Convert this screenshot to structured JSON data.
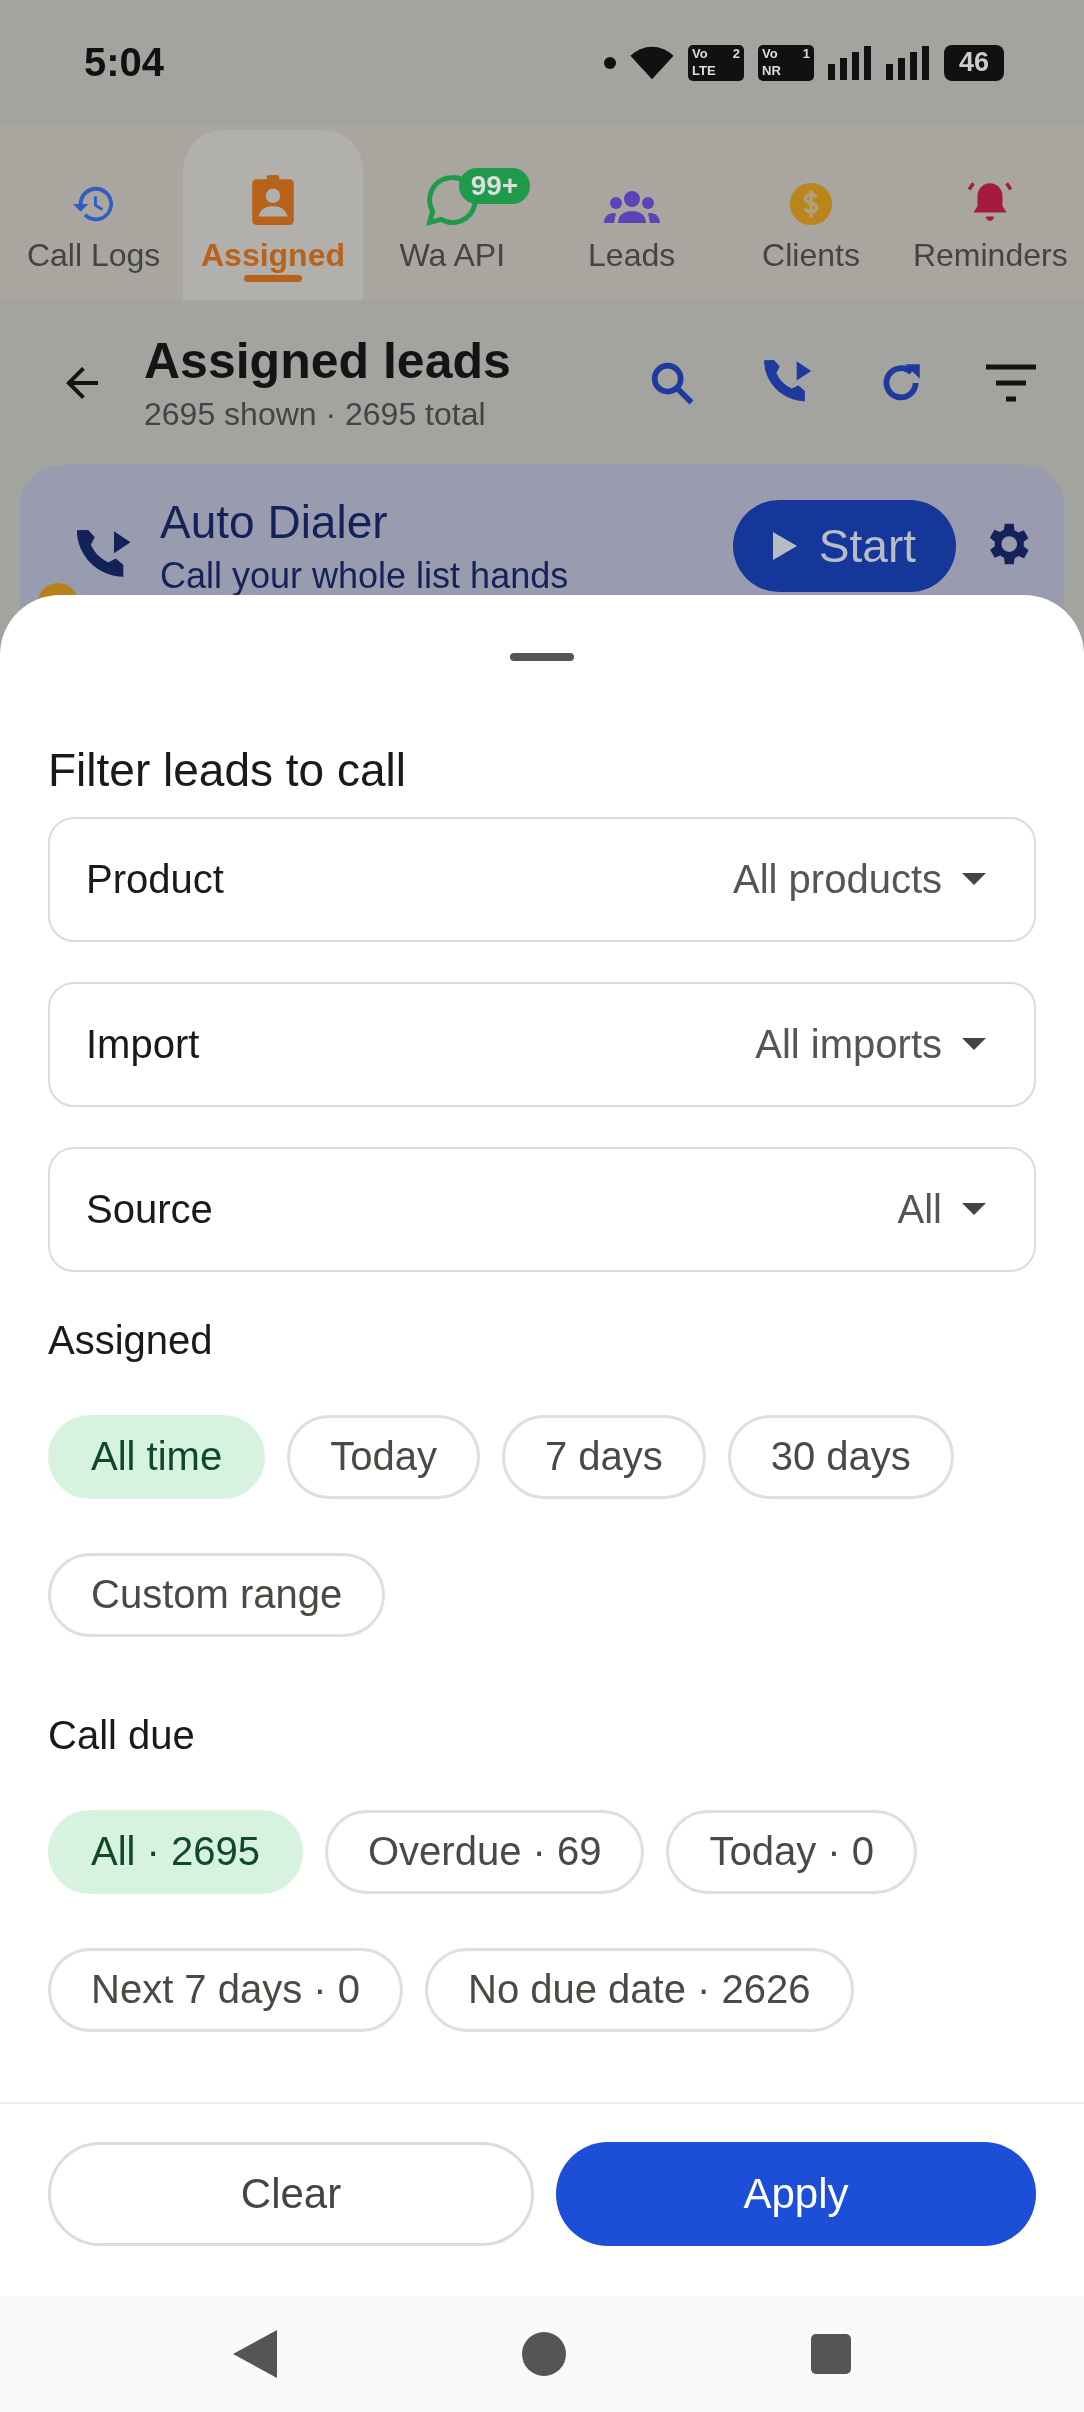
{
  "status_bar": {
    "time": "5:04",
    "sim_badges": [
      {
        "top": "Vo",
        "slot": "2",
        "bottom": "LTE"
      },
      {
        "top": "Vo",
        "slot": "1",
        "bottom": "NR"
      }
    ],
    "battery": "46"
  },
  "nav_tabs": [
    {
      "label": "Call Logs",
      "selected": false
    },
    {
      "label": "Assigned",
      "selected": true
    },
    {
      "label": "Wa API",
      "selected": false,
      "badge": "99+"
    },
    {
      "label": "Leads",
      "selected": false
    },
    {
      "label": "Clients",
      "selected": false
    },
    {
      "label": "Reminders",
      "selected": false
    }
  ],
  "header": {
    "title": "Assigned leads",
    "subtitle": "2695 shown · 2695 total"
  },
  "auto_dialer": {
    "title": "Auto Dialer",
    "subtitle": "Call your whole list hands",
    "button": "Start"
  },
  "filter_sheet": {
    "title": "Filter leads to call",
    "dropdowns": [
      {
        "label": "Product",
        "value": "All products"
      },
      {
        "label": "Import",
        "value": "All imports"
      },
      {
        "label": "Source",
        "value": "All"
      }
    ],
    "sections": [
      {
        "heading": "Assigned",
        "chips": [
          {
            "label": "All time",
            "selected": true
          },
          {
            "label": "Today",
            "selected": false
          },
          {
            "label": "7 days",
            "selected": false
          },
          {
            "label": "30 days",
            "selected": false
          },
          {
            "label": "Custom range",
            "selected": false
          }
        ]
      },
      {
        "heading": "Call due",
        "chips": [
          {
            "label": "All · 2695",
            "selected": true
          },
          {
            "label": "Overdue · 69",
            "selected": false
          },
          {
            "label": "Today · 0",
            "selected": false
          },
          {
            "label": "Next 7 days · 0",
            "selected": false
          },
          {
            "label": "No due date · 2626",
            "selected": false
          }
        ]
      }
    ],
    "clear_button": "Clear",
    "apply_button": "Apply"
  }
}
